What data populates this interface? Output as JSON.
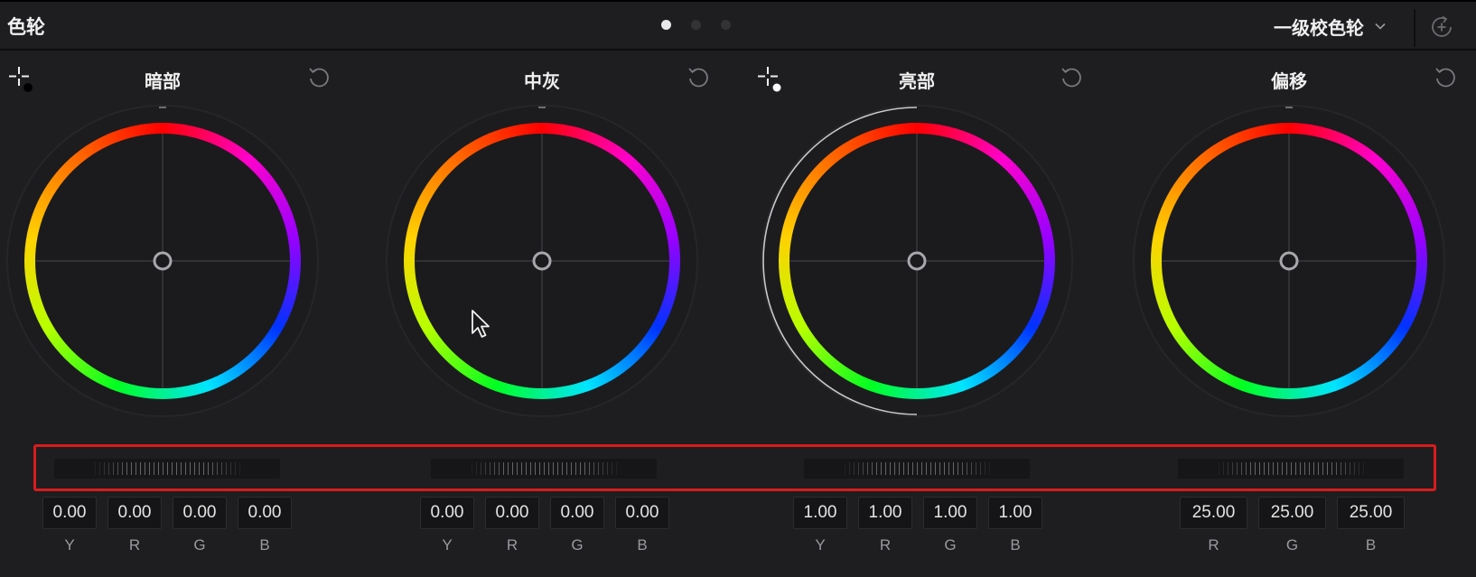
{
  "panel": {
    "title": "色轮"
  },
  "header": {
    "page_dots": [
      true,
      false,
      false
    ],
    "mode_select_label": "一级校色轮"
  },
  "wheels": [
    {
      "title": "暗部",
      "values": [
        "0.00",
        "0.00",
        "0.00",
        "0.00"
      ],
      "labels": [
        "Y",
        "R",
        "G",
        "B"
      ],
      "adjusted_ring": false
    },
    {
      "title": "中灰",
      "values": [
        "0.00",
        "0.00",
        "0.00",
        "0.00"
      ],
      "labels": [
        "Y",
        "R",
        "G",
        "B"
      ],
      "adjusted_ring": false
    },
    {
      "title": "亮部",
      "values": [
        "1.00",
        "1.00",
        "1.00",
        "1.00"
      ],
      "labels": [
        "Y",
        "R",
        "G",
        "B"
      ],
      "adjusted_ring": true
    },
    {
      "title": "偏移",
      "values": [
        "25.00",
        "25.00",
        "25.00"
      ],
      "labels": [
        "R",
        "G",
        "B"
      ],
      "adjusted_ring": false
    }
  ],
  "colors": {
    "panel_bg": "#1e1e21",
    "highlight": "#d81c1c",
    "ring_gradient": [
      "#ff0000",
      "#ff00cc",
      "#9900ff",
      "#0033ff",
      "#00e5ff",
      "#00ff22",
      "#b8ff00",
      "#ffd200",
      "#ff6a00",
      "#ff0000"
    ]
  },
  "icons": {
    "picker": "color-picker-crosshair-icon",
    "reset": "reset-icon",
    "chevron": "chevron-down-icon",
    "add_node": "add-node-icon",
    "cursor": "mouse-pointer-icon"
  }
}
